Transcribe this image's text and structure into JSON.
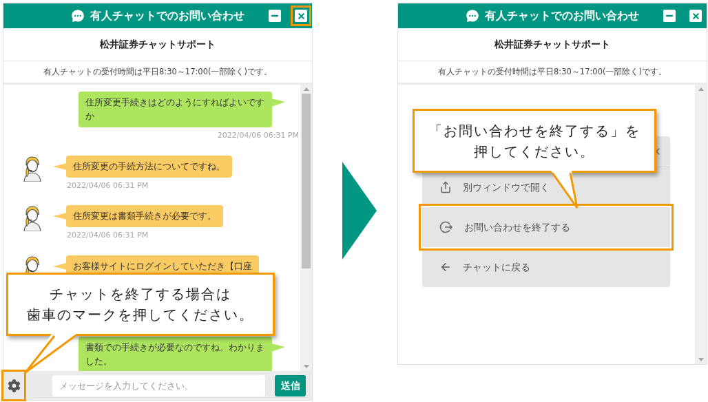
{
  "panels": [
    {
      "header": {
        "title": "有人チャットでのお問い合わせ",
        "buttons": [
          {
            "kind": "minimize",
            "highlighted": false
          },
          {
            "kind": "close",
            "highlighted": true
          }
        ]
      },
      "company": "松井証券チャットサポート",
      "notice": "有人チャットの受付時間は平日8:30～17:00(一部除く)です。",
      "messages": [
        {
          "kind": "user",
          "text": "住所変更手続きはどのようにすればよいですか",
          "time": "2022/04/06 06:31 PM"
        },
        {
          "kind": "agent",
          "text": "住所変更の手続方法についてですね。",
          "time": "2022/04/06 06:31 PM"
        },
        {
          "kind": "agent",
          "text": "住所変更は書類手続きが必要です。",
          "time": "2022/04/06 06:31 PM"
        },
        {
          "kind": "agent",
          "text": "お客様サイトにログインしていただき【口座"
        },
        {
          "kind": "user",
          "text": "書類での手続きが必要なのですね。わかりました。"
        }
      ],
      "composer": {
        "placeholder": "メッセージを入力してください。",
        "send": "送信",
        "settings_highlighted": true
      },
      "callout": {
        "lines": [
          "チャットを終了する場合は",
          "歯車のマークを押してください。"
        ]
      }
    },
    {
      "header": {
        "title": "有人チャットでのお問い合わせ",
        "buttons": [
          {
            "kind": "minimize",
            "highlighted": false
          },
          {
            "kind": "close",
            "highlighted": false
          }
        ]
      },
      "company": "松井証券チャットサポート",
      "notice": "有人チャットの受付時間は平日8:30～17:00(一部除く)です。",
      "menu": {
        "items": [
          {
            "kind": "open-window",
            "label": "別ウィンドウで開く",
            "highlighted": false
          },
          {
            "kind": "end",
            "label": "お問い合わせを終了する",
            "highlighted": true
          },
          {
            "kind": "back",
            "label": "チャットに戻る",
            "highlighted": false
          }
        ]
      },
      "callout": {
        "lines": [
          "「お問い合わせを終了する」を",
          "押してください。"
        ]
      }
    }
  ]
}
